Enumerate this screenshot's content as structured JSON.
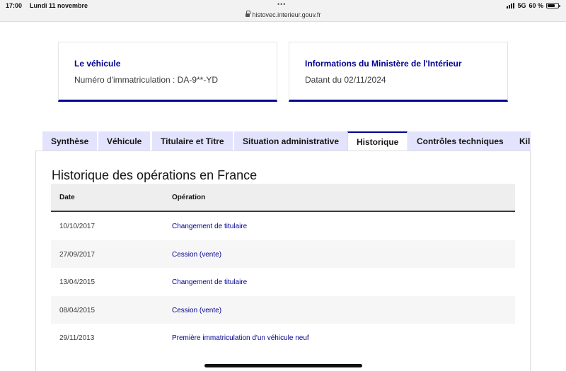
{
  "status_bar": {
    "time": "17:00",
    "date": "Lundi 11 novembre",
    "network": "5G",
    "battery": "60 %",
    "battery_level": 0.6
  },
  "address_bar": {
    "url": "histovec.interieur.gouv.fr"
  },
  "cards": {
    "vehicle": {
      "title": "Le véhicule",
      "text": "Numéro d'immatriculation : DA-9**-YD"
    },
    "ministry": {
      "title": "Informations du Ministère de l'Intérieur",
      "text": "Datant du 02/11/2024"
    }
  },
  "tabs": [
    {
      "label": "Synthèse",
      "active": false
    },
    {
      "label": "Véhicule",
      "active": false
    },
    {
      "label": "Titulaire et Titre",
      "active": false
    },
    {
      "label": "Situation administrative",
      "active": false
    },
    {
      "label": "Historique",
      "active": true
    },
    {
      "label": "Contrôles techniques",
      "active": false
    },
    {
      "label": "Kil",
      "active": false
    }
  ],
  "history": {
    "title": "Historique des opérations en France",
    "columns": [
      "Date",
      "Opération"
    ],
    "rows": [
      {
        "date": "10/10/2017",
        "operation": "Changement de titulaire"
      },
      {
        "date": "27/09/2017",
        "operation": "Cession (vente)"
      },
      {
        "date": "13/04/2015",
        "operation": "Changement de titulaire"
      },
      {
        "date": "08/04/2015",
        "operation": "Cession (vente)"
      },
      {
        "date": "29/11/2013",
        "operation": "Première immatriculation d'un véhicule neuf"
      }
    ]
  },
  "colors": {
    "accent": "#000091",
    "tab_inactive": "#e3e3fd"
  }
}
